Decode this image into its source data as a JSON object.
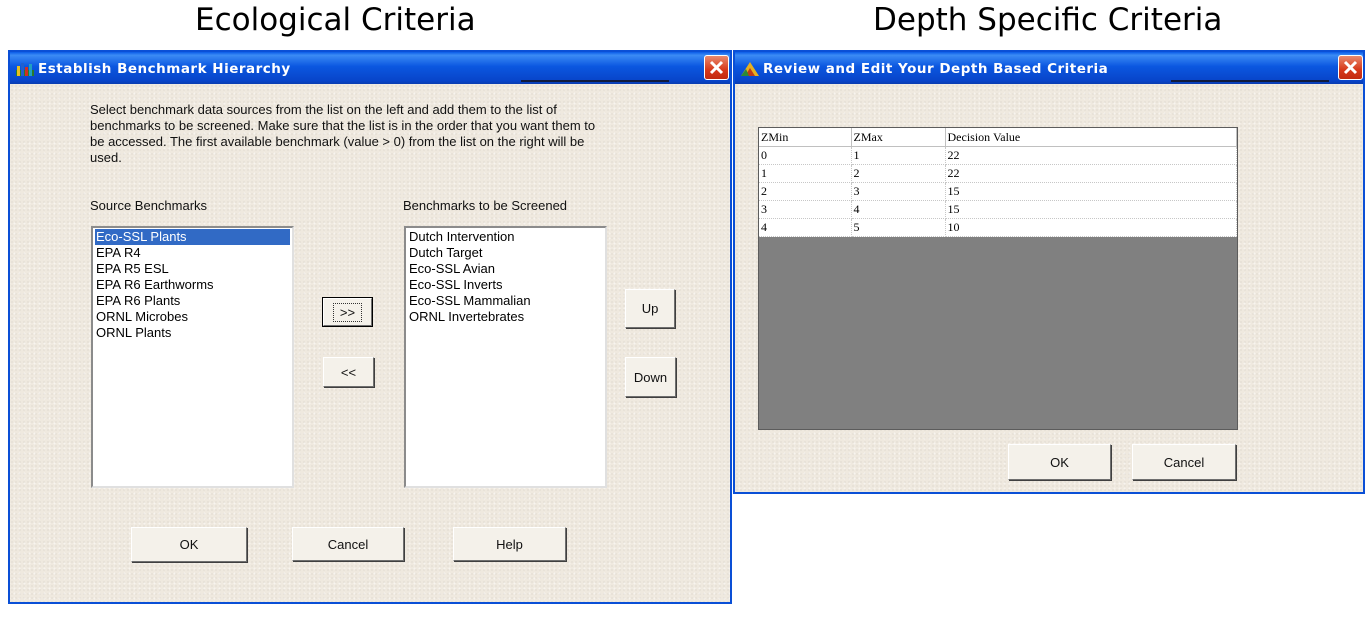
{
  "captions": {
    "left": "Ecological Criteria",
    "right": "Depth Specific Criteria"
  },
  "left_window": {
    "title": "Establish Benchmark Hierarchy",
    "instructions": "Select benchmark data sources from the list on the left and add them to the list of benchmarks to be screened.  Make sure that the list is in the order that you want them to be accessed.  The first available benchmark (value > 0) from the list on the right will be used.",
    "source_label": "Source Benchmarks",
    "screened_label": "Benchmarks to be Screened",
    "source_items": [
      "Eco-SSL Plants",
      "EPA R4",
      "EPA R5 ESL",
      "EPA R6 Earthworms",
      "EPA R6 Plants",
      "ORNL Microbes",
      "ORNL Plants"
    ],
    "selected_source": "Eco-SSL Plants",
    "screened_items": [
      "Dutch Intervention",
      "Dutch Target",
      "Eco-SSL Avian",
      "Eco-SSL Inverts",
      "Eco-SSL Mammalian",
      "ORNL Invertebrates"
    ],
    "add_label": ">>",
    "remove_label": "<<",
    "up_label": "Up",
    "down_label": "Down",
    "ok_label": "OK",
    "cancel_label": "Cancel",
    "help_label": "Help"
  },
  "right_window": {
    "title": "Review and Edit Your Depth Based Criteria",
    "columns": [
      "ZMin",
      "ZMax",
      "Decision Value"
    ],
    "rows": [
      [
        "0",
        "1",
        "22"
      ],
      [
        "1",
        "2",
        "22"
      ],
      [
        "2",
        "3",
        "15"
      ],
      [
        "3",
        "4",
        "15"
      ],
      [
        "4",
        "5",
        "10"
      ]
    ],
    "ok_label": "OK",
    "cancel_label": "Cancel"
  },
  "colors": {
    "titlebar": "#0b57e0",
    "selection": "#316ac5",
    "close": "#d7381a"
  }
}
